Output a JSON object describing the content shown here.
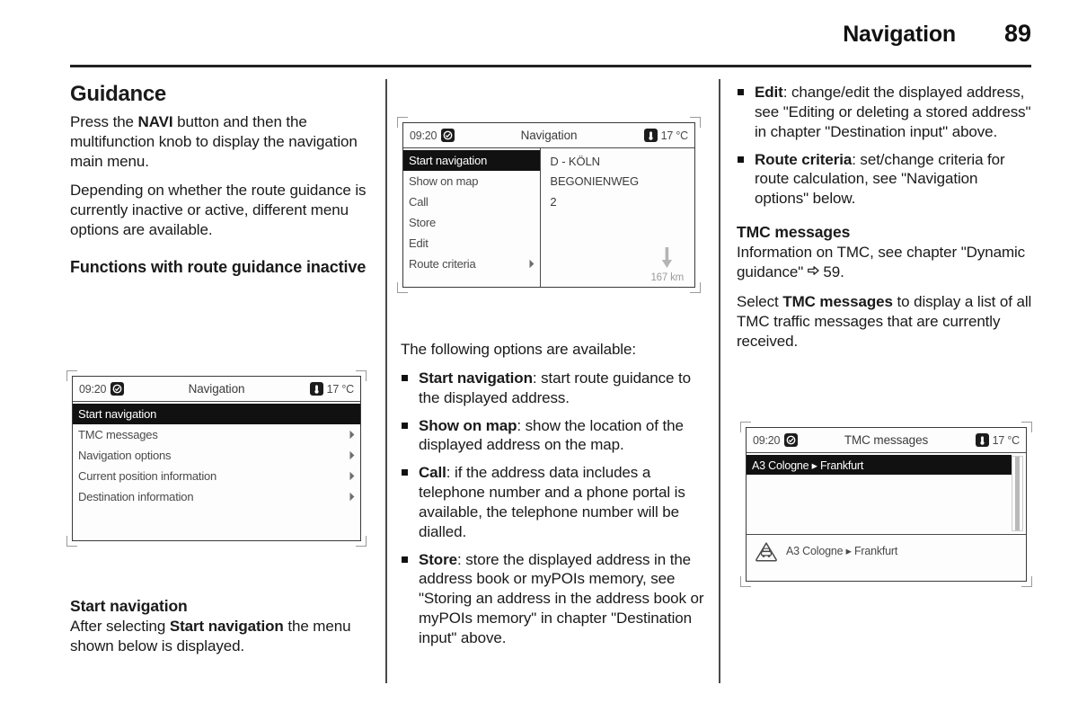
{
  "header": {
    "chapter_title": "Navigation",
    "page_number": "89"
  },
  "column_left": {
    "heading": "Guidance",
    "para_1_pre": "Press the ",
    "para_1_bold": "NAVI",
    "para_1_post": " button and then the multifunction knob to display the navigation main menu.",
    "para_2": "Depending on whether the route guidance is currently inactive or active, different menu options are available.",
    "subheading": "Functions with route guidance inactive",
    "start_nav_heading": "Start navigation",
    "start_nav_pre": "After selecting ",
    "start_nav_bold": "Start navigation",
    "start_nav_post": " the menu shown below is displayed."
  },
  "screen_main_menu": {
    "time": "09:20",
    "clock_icon": "clock-icon",
    "title": "Navigation",
    "temp_icon": "thermometer-icon",
    "temperature": "17 °C",
    "items": [
      {
        "label": "Start navigation",
        "selected": true,
        "submenu": false
      },
      {
        "label": "TMC messages",
        "selected": false,
        "submenu": true
      },
      {
        "label": "Navigation options",
        "selected": false,
        "submenu": true
      },
      {
        "label": "Current position information",
        "selected": false,
        "submenu": true
      },
      {
        "label": "Destination information",
        "selected": false,
        "submenu": true
      }
    ]
  },
  "screen_start_navigation": {
    "time": "09:20",
    "clock_icon": "clock-icon",
    "title": "Navigation",
    "temp_icon": "thermometer-icon",
    "temperature": "17 °C",
    "items": [
      {
        "label": "Start navigation",
        "selected": true,
        "submenu": false
      },
      {
        "label": "Show on map",
        "selected": false,
        "submenu": false
      },
      {
        "label": "Call",
        "selected": false,
        "submenu": false
      },
      {
        "label": "Store",
        "selected": false,
        "submenu": false
      },
      {
        "label": "Edit",
        "selected": false,
        "submenu": false
      },
      {
        "label": "Route criteria",
        "selected": false,
        "submenu": true
      }
    ],
    "address": {
      "line_1": "D - KÖLN",
      "line_2": "BEGONIENWEG",
      "line_3": "2"
    },
    "distance": "167 km",
    "distance_icon": "down-arrow-icon"
  },
  "column_middle": {
    "intro": "The following options are available:",
    "options": [
      {
        "term": "Start navigation",
        "desc": ": start route guidance to the displayed address."
      },
      {
        "term": "Show on map",
        "desc": ": show the location of the displayed address on the map."
      },
      {
        "term": "Call",
        "desc": ": if the address data includes a telephone number and a phone portal is available, the telephone number will be dialled."
      },
      {
        "term": "Store",
        "desc": ": store the displayed address in the address book or myPOIs memory, see \"Storing an address in the address book or myPOIs memory\" in chapter \"Destination input\" above."
      }
    ]
  },
  "column_right": {
    "options": [
      {
        "term": "Edit",
        "desc": ": change/edit the displayed address, see \"Editing or deleting a stored address\" in chapter \"Destination input\" above."
      },
      {
        "term": "Route criteria",
        "desc": ": set/change criteria for route calculation, see \"Navigation options\" below."
      }
    ],
    "tmc_heading": "TMC messages",
    "tmc_para_1_pre": "Information on TMC, see chapter \"Dynamic guidance\" ",
    "tmc_xref_icon": "cross-reference-arrow-icon",
    "tmc_xref_page": " 59.",
    "tmc_para_2_pre": "Select ",
    "tmc_para_2_bold": "TMC messages",
    "tmc_para_2_post": " to display a list of all TMC traffic messages that are currently received."
  },
  "screen_tmc": {
    "time": "09:20",
    "clock_icon": "clock-icon",
    "title": "TMC messages",
    "temp_icon": "thermometer-icon",
    "temperature": "17 °C",
    "list_items": [
      {
        "label": "A3 Cologne ▸ Frankfurt",
        "selected": true
      }
    ],
    "footer_icon": "traffic-warning-icon",
    "footer_text": "A3 Cologne ▸ Frankfurt"
  }
}
